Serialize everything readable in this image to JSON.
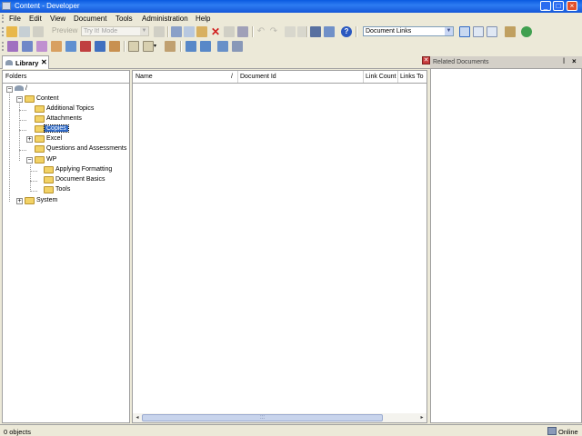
{
  "window": {
    "title": "Content - Developer"
  },
  "menu": [
    "File",
    "Edit",
    "View",
    "Document",
    "Tools",
    "Administration",
    "Help"
  ],
  "toolbar": {
    "preview_label": "Preview",
    "mode_value": "Try It! Mode",
    "view_combo_value": "Document Links"
  },
  "tabs": {
    "library": "Library"
  },
  "folders": {
    "header": "Folders",
    "root": "/",
    "content": "Content",
    "items": [
      "Additional Topics",
      "Attachments",
      "Copies",
      "Excel",
      "Questions and Assessments",
      "WP"
    ],
    "wp_children": [
      "Applying Formatting",
      "Document Basics",
      "Tools"
    ],
    "system": "System"
  },
  "documents": {
    "columns": [
      "Name",
      "Document Id",
      "Link Count",
      "Links To"
    ]
  },
  "related": {
    "title": "Related Documents"
  },
  "status": {
    "objects": "0 objects",
    "connection": "Online"
  }
}
